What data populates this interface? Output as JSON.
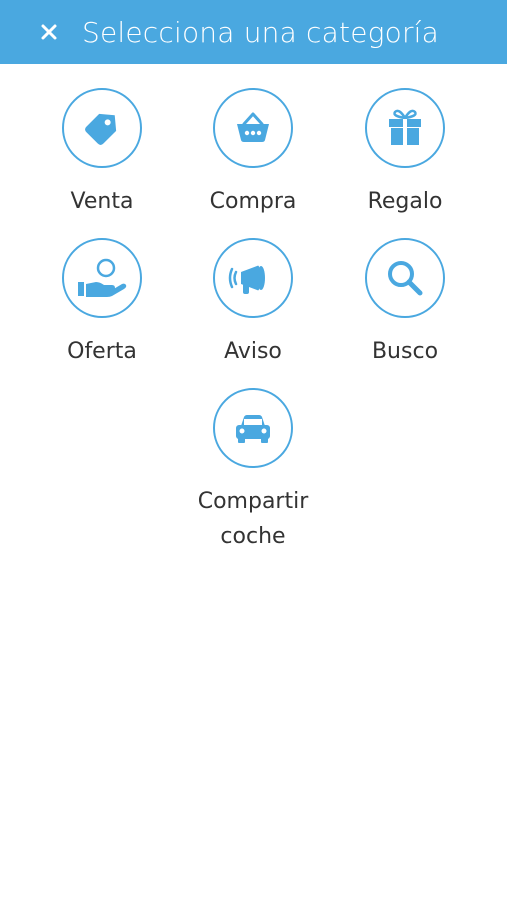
{
  "header": {
    "title": "Selecciona una categoría",
    "close_icon": "close-icon"
  },
  "colors": {
    "accent": "#4aa8e0",
    "text": "#333333",
    "background": "#ffffff"
  },
  "categories": [
    {
      "label": "Venta",
      "icon": "tag-icon"
    },
    {
      "label": "Compra",
      "icon": "basket-icon"
    },
    {
      "label": "Regalo",
      "icon": "gift-icon"
    },
    {
      "label": "Oferta",
      "icon": "hand-offer-icon"
    },
    {
      "label": "Aviso",
      "icon": "megaphone-icon"
    },
    {
      "label": "Busco",
      "icon": "search-icon"
    },
    {
      "label": "Compartir\ncoche",
      "icon": "car-icon"
    }
  ]
}
